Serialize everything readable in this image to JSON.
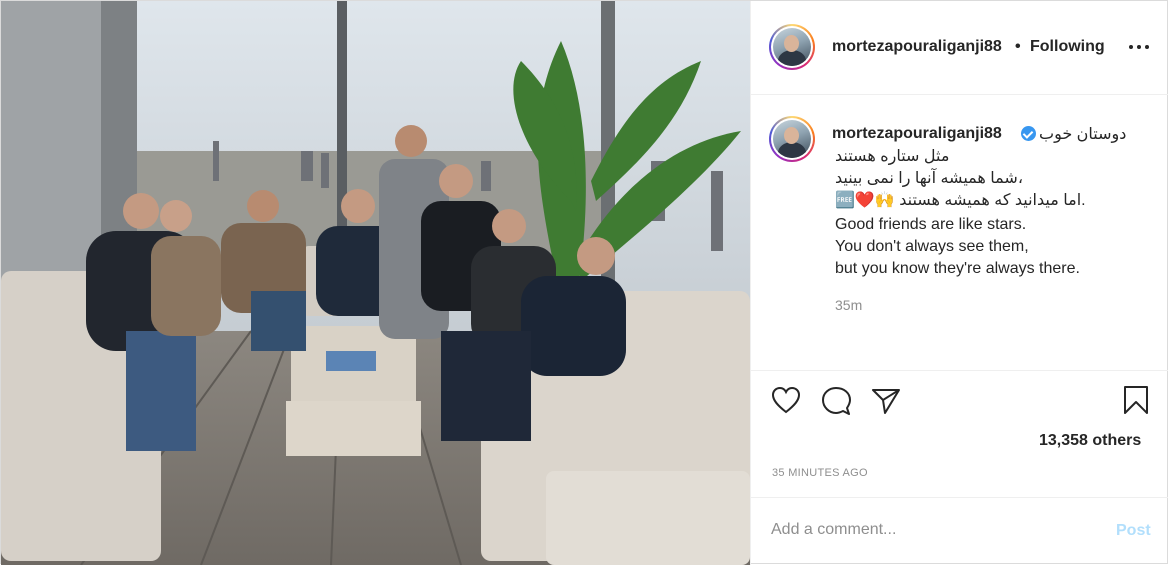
{
  "photo": {
    "alt": "group-photo"
  },
  "header": {
    "username": "mortezapouraliganji88",
    "separator": "•",
    "follow_status": "Following",
    "more_icon": "ellipsis-icon"
  },
  "caption": {
    "username": "mortezapouraliganji88",
    "lines": [
      "دوستان خوب",
      "مثل ستاره هستند",
      "،شما همیشه آنها را نمی بینید",
      ".اما میدانید که همیشه هستند 🙌❤️🆓",
      "Good friends are like stars.",
      "You don't always see them,",
      "but you know they're always there."
    ],
    "time": "35m"
  },
  "actions": {
    "like_icon": "heart-icon",
    "comment_icon": "comment-icon",
    "share_icon": "share-icon",
    "save_icon": "bookmark-icon"
  },
  "likes": "13,358 others",
  "timestamp": "35 MINUTES AGO",
  "comment": {
    "placeholder": "Add a comment...",
    "post_label": "Post"
  },
  "colors": {
    "verified": "#3897f0",
    "post_disabled": "#b2dffc",
    "muted": "#8e8e8e"
  }
}
